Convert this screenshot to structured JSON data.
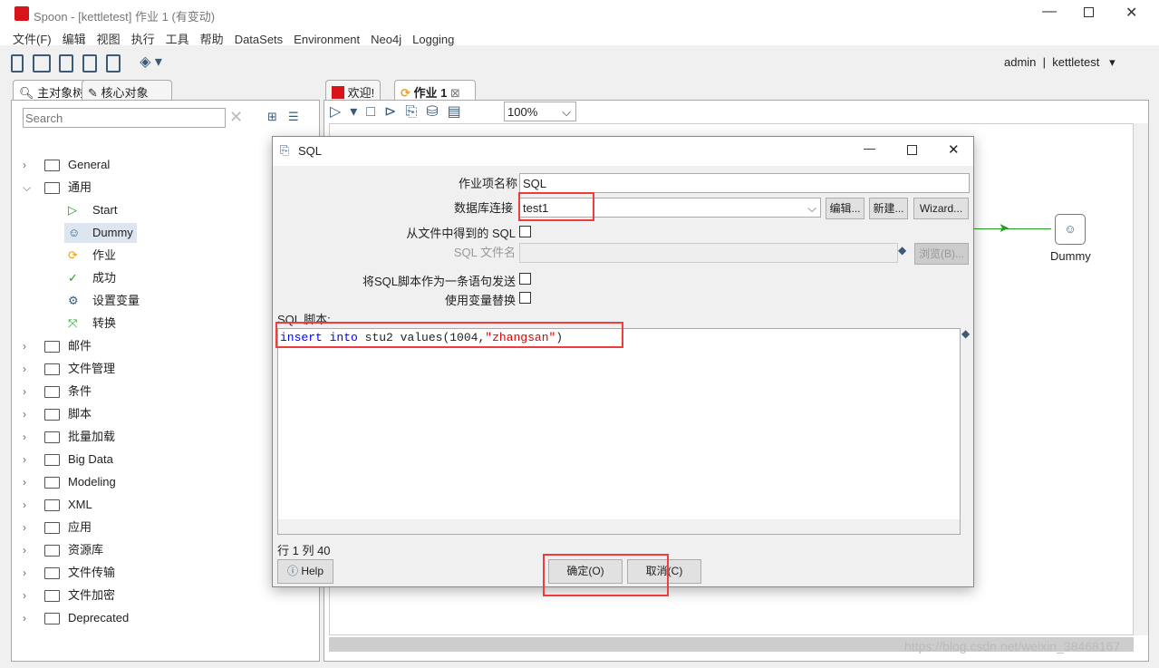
{
  "window": {
    "title": "Spoon - [kettletest] 作业 1 (有变动)",
    "user": "admin",
    "separator": "|",
    "repo": "kettletest"
  },
  "menu": [
    "文件(F)",
    "编辑",
    "视图",
    "执行",
    "工具",
    "帮助",
    "DataSets",
    "Environment",
    "Neo4j",
    "Logging"
  ],
  "left": {
    "tabs": [
      "主对象树",
      "核心对象"
    ],
    "search_placeholder": "Search",
    "tree": [
      {
        "label": "General",
        "level": 0,
        "expanded": false
      },
      {
        "label": "通用",
        "level": 0,
        "expanded": true
      },
      {
        "label": "Start",
        "level": 1,
        "icon": "start-icon"
      },
      {
        "label": "Dummy",
        "level": 1,
        "icon": "dummy-icon",
        "selected": true
      },
      {
        "label": "作业",
        "level": 1,
        "icon": "job-icon"
      },
      {
        "label": "成功",
        "level": 1,
        "icon": "success-icon"
      },
      {
        "label": "设置变量",
        "level": 1,
        "icon": "set-variable-icon"
      },
      {
        "label": "转换",
        "level": 1,
        "icon": "transform-icon"
      },
      {
        "label": "邮件",
        "level": 0
      },
      {
        "label": "文件管理",
        "level": 0
      },
      {
        "label": "条件",
        "level": 0
      },
      {
        "label": "脚本",
        "level": 0
      },
      {
        "label": "批量加载",
        "level": 0
      },
      {
        "label": "Big Data",
        "level": 0
      },
      {
        "label": "Modeling",
        "level": 0
      },
      {
        "label": "XML",
        "level": 0
      },
      {
        "label": "应用",
        "level": 0
      },
      {
        "label": "资源库",
        "level": 0
      },
      {
        "label": "文件传输",
        "level": 0
      },
      {
        "label": "文件加密",
        "level": 0
      },
      {
        "label": "Deprecated",
        "level": 0
      }
    ]
  },
  "right": {
    "tabs": [
      "欢迎!",
      "作业 1"
    ],
    "zoom": "100%",
    "canvas": {
      "node_label": "Dummy",
      "hop_color": "#1fa01f"
    }
  },
  "dialog": {
    "title": "SQL",
    "name_label": "作业项名称",
    "name_value": "SQL",
    "conn_label": "数据库连接",
    "conn_value": "test1",
    "edit_btn": "编辑...",
    "new_btn": "新建...",
    "wizard_btn": "Wizard...",
    "from_file_label": "从文件中得到的 SQL",
    "from_file_checked": false,
    "file_label": "SQL 文件名",
    "browse_btn": "浏览(B)...",
    "single_stmt_label": "将SQL脚本作为一条语句发送",
    "single_stmt_checked": false,
    "var_sub_label": "使用变量替换",
    "var_sub_checked": false,
    "script_label": "SQL 脚本:",
    "script": {
      "kw1": "insert",
      "kw2": "into",
      "plain": " stu2 values(1004,",
      "str": "\"zhangsan\"",
      "tail": ")"
    },
    "position": "行 1 列 40",
    "help_btn": "Help",
    "ok_btn": "确定(O)",
    "cancel_btn": "取消(C)"
  },
  "watermark": "https://blog.csdn.net/weixin_38468167",
  "colors": {
    "highlight": "#f03c3c",
    "keyword": "#0000ff",
    "string": "#e00000"
  }
}
